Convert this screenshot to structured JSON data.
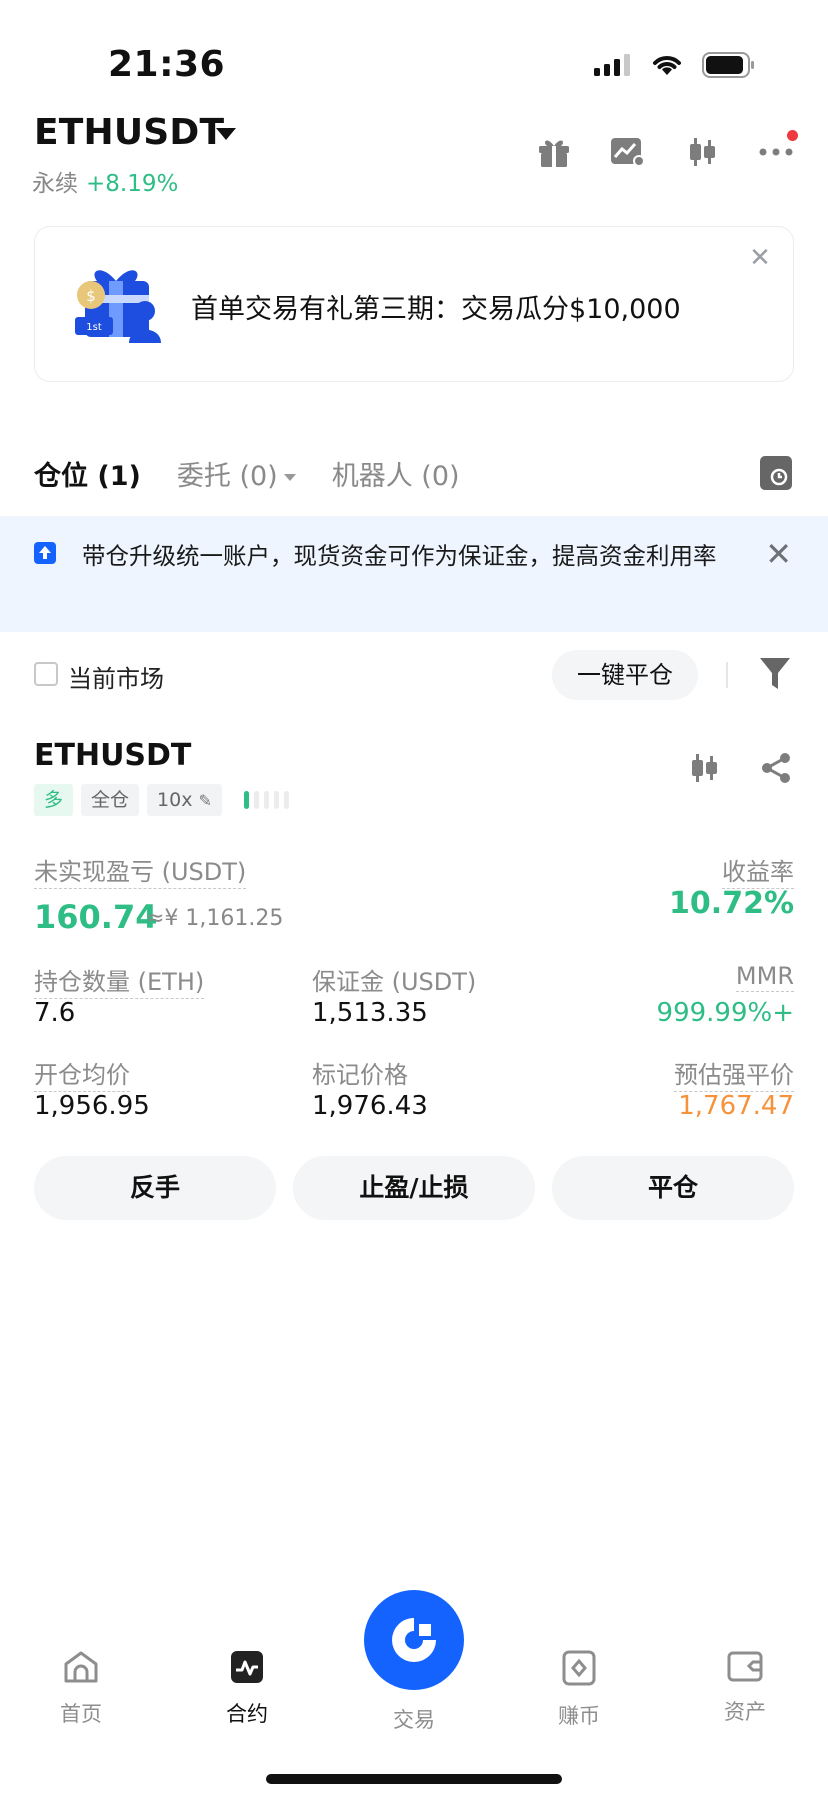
{
  "status_bar": {
    "time": "21:36"
  },
  "header": {
    "pair": "ETHUSDT",
    "contract_type": "永续",
    "change": "+8.19%",
    "icons": [
      "gift-icon",
      "chart-icon",
      "candlestick-icon",
      "more-icon"
    ]
  },
  "promo": {
    "text": "首单交易有礼第三期：交易瓜分$10,000",
    "close": "✕",
    "badge": "1st"
  },
  "tabs": [
    {
      "label": "仓位 (1)"
    },
    {
      "label": "委托 (0)"
    },
    {
      "label": "机器人 (0)"
    }
  ],
  "notice": {
    "text": "带仓升级统一账户，现货资金可作为保证金，提高资金利用率",
    "close": "✕"
  },
  "filter": {
    "current_market": "当前市场",
    "close_all": "一键平仓"
  },
  "position": {
    "symbol": "ETHUSDT",
    "side": "多",
    "margin_mode": "全仓",
    "leverage": "10x",
    "unrealized_pnl_label": "未实现盈亏 (USDT)",
    "unrealized_pnl": "160.74",
    "unrealized_pnl_cny": "≈¥ 1,161.25",
    "roe_label": "收益率",
    "roe": "10.72%",
    "size_label": "持仓数量 (ETH)",
    "size": "7.6",
    "margin_label": "保证金 (USDT)",
    "margin": "1,513.35",
    "mmr_label": "MMR",
    "mmr": "999.99%+",
    "entry_label": "开仓均价",
    "entry": "1,956.95",
    "mark_label": "标记价格",
    "mark": "1,976.43",
    "liq_label": "预估强平价",
    "liq": "1,767.47"
  },
  "actions": {
    "reverse": "反手",
    "tpsl": "止盈/止损",
    "close": "平仓"
  },
  "nav": {
    "home": "首页",
    "futures": "合约",
    "trade": "交易",
    "earn": "赚币",
    "assets": "资产"
  },
  "colors": {
    "accent": "#1463ff",
    "up": "#2ebd85",
    "warn": "#f7923b"
  }
}
